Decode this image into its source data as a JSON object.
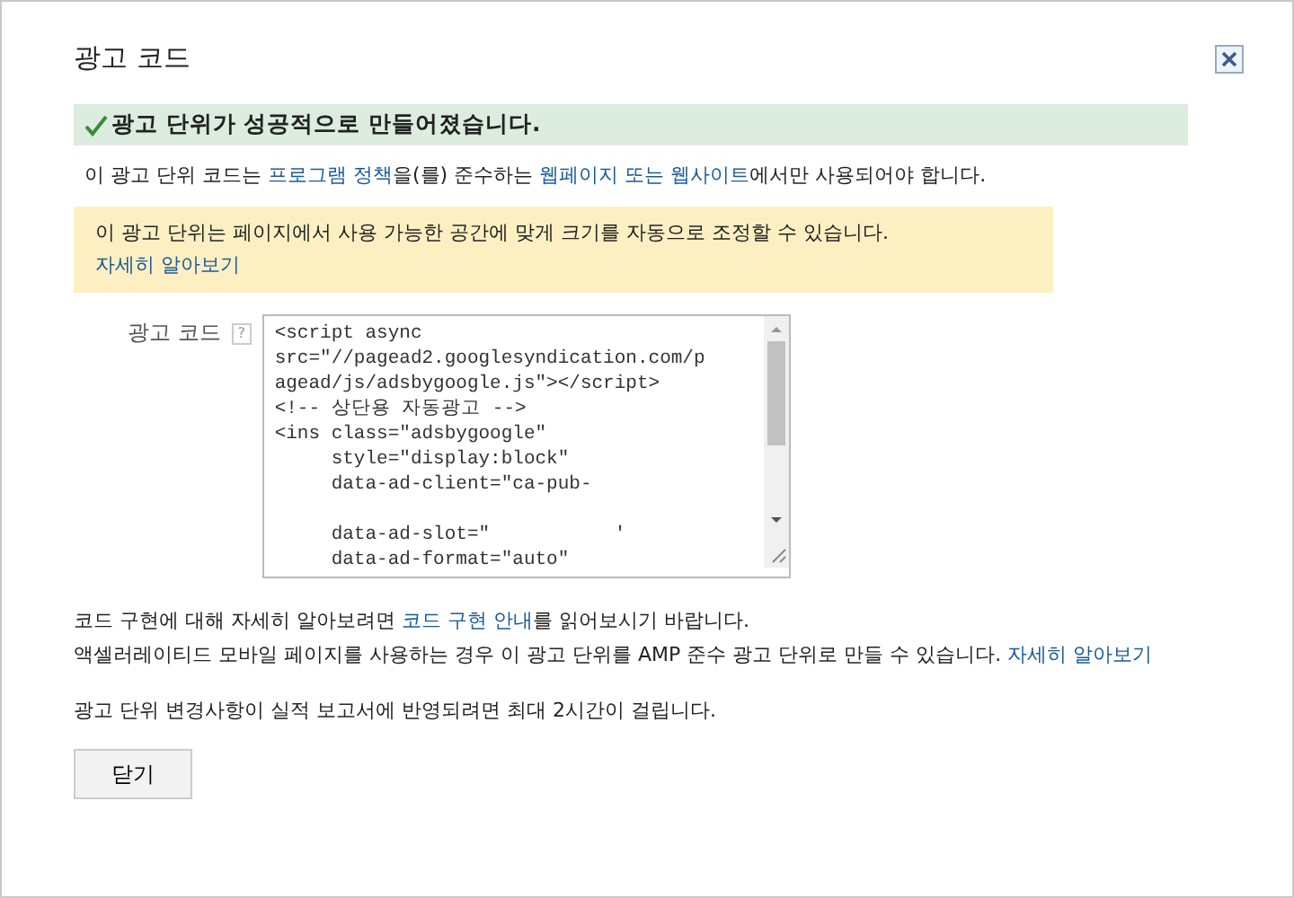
{
  "dialog": {
    "title": "광고 코드",
    "success": "광고 단위가 성공적으로 만들어졌습니다.",
    "policy": [
      {
        "kind": "text",
        "text": "이 광고 단위 코드는 "
      },
      {
        "kind": "link",
        "text": "프로그램 정책"
      },
      {
        "kind": "text",
        "text": "을(를) 준수하는 "
      },
      {
        "kind": "link",
        "text": "웹페이지 또는 웹사이트"
      },
      {
        "kind": "text",
        "text": "에서만 사용되어야 합니다."
      }
    ],
    "notice": [
      {
        "kind": "text",
        "text": "이 광고 단위는 페이지에서 사용 가능한 공간에 맞게 크기를 자동으로 조정할 수 있습니다.   "
      },
      {
        "kind": "link",
        "text": "자세히 알아보기"
      }
    ],
    "code_label": "광고 코드",
    "help_icon": "?",
    "code": "<script async\nsrc=\"//pagead2.googlesyndication.com/p\nagead/js/adsbygoogle.js\"></script>\n<!-- 상단용 자동광고 -->\n<ins class=\"adsbygoogle\"\n     style=\"display:block\"\n     data-ad-client=\"ca-pub-\n\n     data-ad-slot=\"           '\n     data-ad-format=\"auto\"",
    "info": [
      [
        {
          "kind": "text",
          "text": "코드 구현에 대해 자세히 알아보려면 "
        },
        {
          "kind": "link",
          "text": "코드 구현 안내"
        },
        {
          "kind": "text",
          "text": "를 읽어보시기 바랍니다."
        }
      ],
      [
        {
          "kind": "text",
          "text": "액셀러레이티드 모바일 페이지를 사용하는 경우 이 광고 단위를 AMP 준수 광고 단위로 만들 수 있습니다. "
        },
        {
          "kind": "link",
          "text": "자세히 알아보기"
        }
      ]
    ],
    "delay_note": "광고 단위 변경사항이 실적 보고서에 반영되려면 최대 2시간이 걸립니다.",
    "close_button": "닫기"
  }
}
